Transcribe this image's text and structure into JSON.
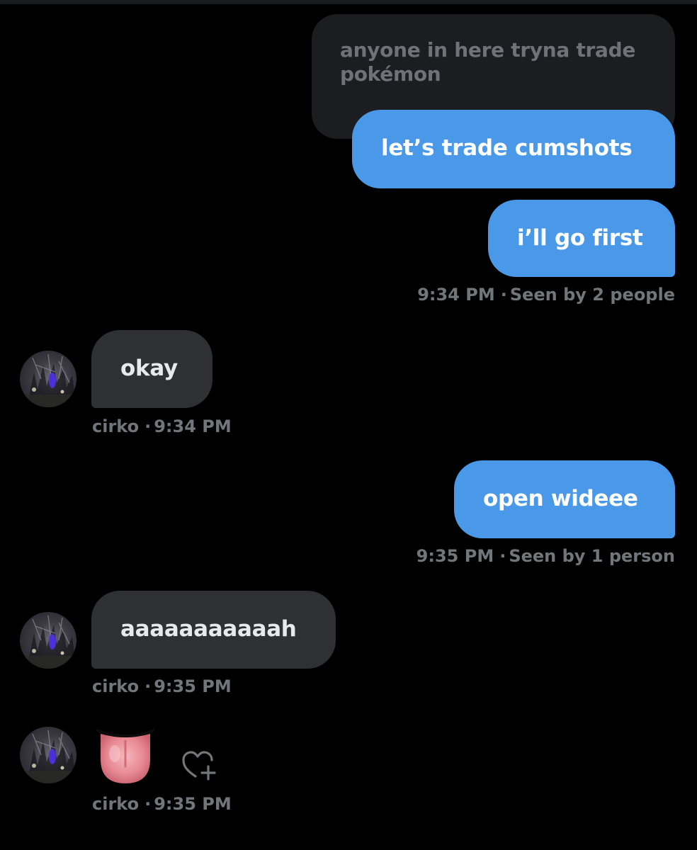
{
  "colors": {
    "background": "#000000",
    "sent_bubble": "#4a99e9",
    "received_bubble": "#2f3033",
    "quoted_bubble": "#1c1d20",
    "meta_text": "#71767b"
  },
  "conversation": {
    "quoted_message": {
      "text": "anyone in here tryna trade pokémon"
    },
    "messages": [
      {
        "text": "let’s trade cumshots"
      },
      {
        "text": "i’ll go first"
      },
      {
        "text": "okay"
      },
      {
        "text": "open wideee"
      },
      {
        "text": "aaaaaaaaaaah"
      },
      {
        "emoji": "tongue-emoji"
      }
    ],
    "meta": [
      {
        "time": "9:34 PM",
        "seen": "Seen by 2 people"
      },
      {
        "sender": "cirko",
        "time": "9:34 PM"
      },
      {
        "time": "9:35 PM",
        "seen": "Seen by 1 person"
      },
      {
        "sender": "cirko",
        "time": "9:35 PM"
      },
      {
        "sender": "cirko",
        "time": "9:35 PM"
      }
    ],
    "dot": "·",
    "avatar_icon": "user-avatar",
    "reaction_icon": "add-reaction-heart-icon"
  }
}
